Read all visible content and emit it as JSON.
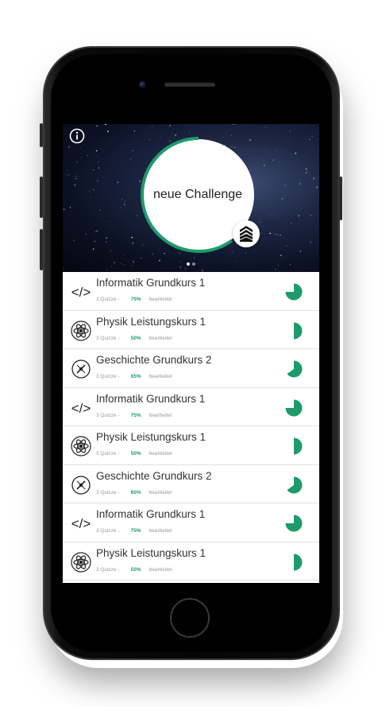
{
  "hero": {
    "title": "neue Challenge",
    "progress": 0.6,
    "page_count": 2,
    "active_page": 0
  },
  "courses": [
    {
      "title": "Informatik Grundkurs 1",
      "quizzes": "3 Quizze -",
      "percent": "75%",
      "status": "bearbeitet",
      "progress": 0.75,
      "icon": "code-icon"
    },
    {
      "title": "Physik Leistungskurs 1",
      "quizzes": "3 Quizze -",
      "percent": "50%",
      "status": "bearbeitet",
      "progress": 0.5,
      "icon": "atom-icon"
    },
    {
      "title": "Geschichte Grundkurs 2",
      "quizzes": "3 Quizze -",
      "percent": "65%",
      "status": "bearbeitet",
      "progress": 0.65,
      "icon": "compass-icon"
    },
    {
      "title": "Informatik Grundkurs 1",
      "quizzes": "3 Quizze -",
      "percent": "75%",
      "status": "bearbeitet",
      "progress": 0.75,
      "icon": "code-icon"
    },
    {
      "title": "Physik Leistungskurs 1",
      "quizzes": "3 Quizze -",
      "percent": "50%",
      "status": "bearbeitet",
      "progress": 0.5,
      "icon": "atom-icon"
    },
    {
      "title": "Geschichte Grundkurs 2",
      "quizzes": "3 Quizze -",
      "percent": "65%",
      "status": "bearbeitet",
      "progress": 0.65,
      "icon": "compass-icon"
    },
    {
      "title": "Informatik Grundkurs 1",
      "quizzes": "3 Quizze -",
      "percent": "75%",
      "status": "bearbeitet",
      "progress": 0.75,
      "icon": "code-icon"
    },
    {
      "title": "Physik Leistungskurs 1",
      "quizzes": "3 Quizze -",
      "percent": "50%",
      "status": "bearbeitet",
      "progress": 0.5,
      "icon": "atom-icon"
    }
  ],
  "colors": {
    "accent": "#1e9b6a",
    "text": "#333333",
    "meta": "#9a9a9a"
  }
}
